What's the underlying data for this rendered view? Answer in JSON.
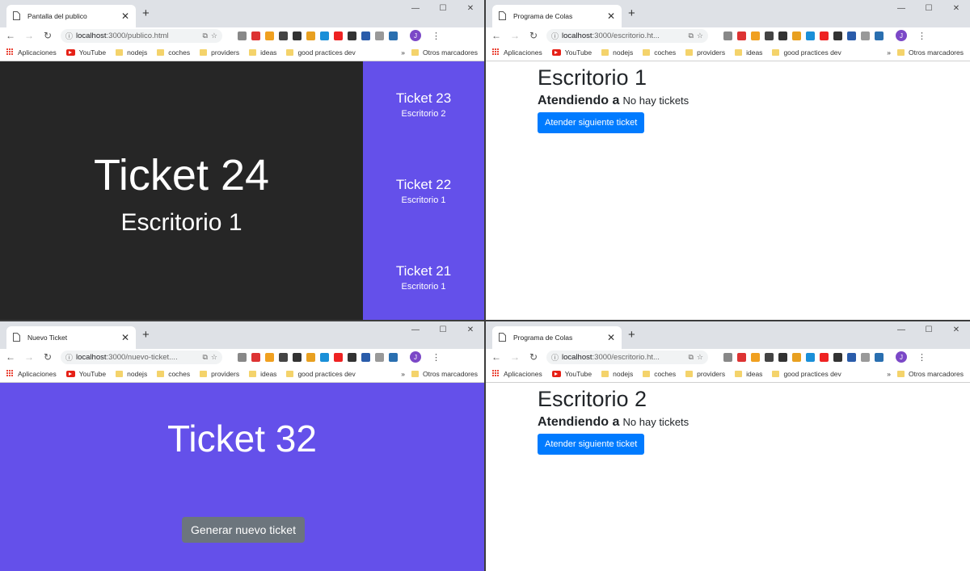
{
  "bookmarks": {
    "apps": "Aplicaciones",
    "youtube": "YouTube",
    "folders": [
      "nodejs",
      "coches",
      "providers",
      "ideas",
      "good practices dev"
    ],
    "more": "»",
    "other": "Otros marcadores"
  },
  "windows": {
    "publico": {
      "tab_title": "Pantalla del publico",
      "url_host": "localhost",
      "url_path": ":3000/publico.html",
      "main_ticket": "Ticket 24",
      "main_desk": "Escritorio 1",
      "side": [
        {
          "ticket": "Ticket 23",
          "desk": "Escritorio 2"
        },
        {
          "ticket": "Ticket 22",
          "desk": "Escritorio 1"
        },
        {
          "ticket": "Ticket 21",
          "desk": "Escritorio 1"
        }
      ]
    },
    "escritorio1": {
      "tab_title": "Programa de Colas",
      "url_host": "localhost",
      "url_path": ":3000/escritorio.ht...",
      "heading": "Escritorio 1",
      "attending_label": "Atendiendo a",
      "attending_value": "No hay tickets",
      "button": "Atender siguiente ticket"
    },
    "nuevo": {
      "tab_title": "Nuevo Ticket",
      "url_host": "localhost",
      "url_path": ":3000/nuevo-ticket....",
      "ticket": "Ticket 32",
      "button": "Generar nuevo ticket"
    },
    "escritorio2": {
      "tab_title": "Programa de Colas",
      "url_host": "localhost",
      "url_path": ":3000/escritorio.ht...",
      "heading": "Escritorio 2",
      "attending_label": "Atendiendo a",
      "attending_value": "No hay tickets",
      "button": "Atender siguiente ticket"
    }
  },
  "colors": {
    "purple": "#6450ea",
    "dark": "#262626",
    "blue_button": "#007bff",
    "grey_button": "#6c757d"
  }
}
